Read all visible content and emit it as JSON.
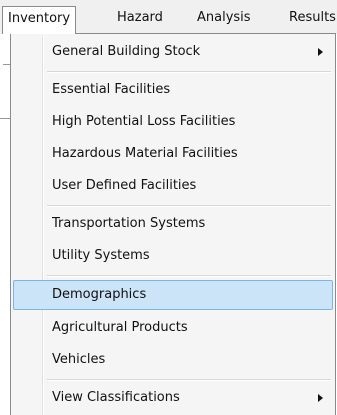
{
  "menubar": {
    "items": [
      {
        "label": "Inventory"
      },
      {
        "label": "Hazard"
      },
      {
        "label": "Analysis"
      },
      {
        "label": "Results"
      }
    ]
  },
  "dropdown": {
    "items": [
      {
        "label": "General Building Stock",
        "submenu": true
      },
      {
        "label": "Essential Facilities"
      },
      {
        "label": "High Potential Loss Facilities"
      },
      {
        "label": "Hazardous Material Facilities"
      },
      {
        "label": "User Defined Facilities"
      },
      {
        "label": "Transportation Systems"
      },
      {
        "label": "Utility Systems"
      },
      {
        "label": "Demographics",
        "highlighted": true
      },
      {
        "label": "Agricultural Products"
      },
      {
        "label": "Vehicles"
      },
      {
        "label": "View Classifications",
        "submenu": true
      }
    ]
  },
  "colors": {
    "highlight_fill": "#cce4f7",
    "highlight_border": "#7eb4ea",
    "menu_background": "#f5f5f5",
    "menubar_background": "#f0f0f0"
  }
}
